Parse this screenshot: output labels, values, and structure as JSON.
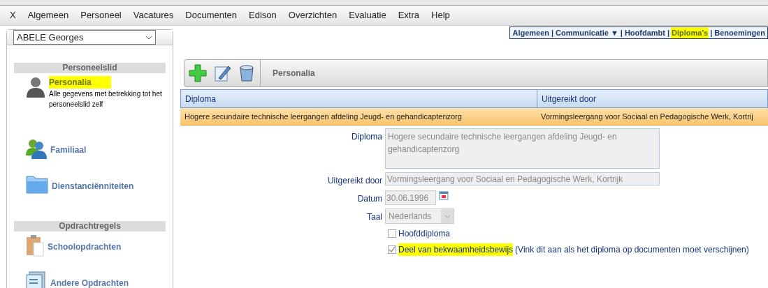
{
  "menu": [
    "X",
    "Algemeen",
    "Personeel",
    "Vacatures",
    "Documenten",
    "Edison",
    "Overzichten",
    "Evaluatie",
    "Extra",
    "Help"
  ],
  "person_select": {
    "value": "ABELE Georges"
  },
  "sidebar": [
    {
      "heading": "Personeelslid",
      "items": [
        {
          "kind": "person",
          "label": "Personalia",
          "description": "Alle gegevens met betrekking tot het personeelslid zelf",
          "selected": true,
          "highlighted": true
        },
        {
          "kind": "people",
          "label": "Familiaal",
          "selected": false,
          "highlighted": false
        },
        {
          "kind": "folder",
          "label": "Dienstanciënniteiten",
          "selected": false,
          "highlighted": false
        }
      ]
    },
    {
      "heading": "Opdrachtregels",
      "items": [
        {
          "kind": "clipboard",
          "label": "Schoolopdrachten",
          "selected": false,
          "highlighted": false
        },
        {
          "kind": "documents",
          "label": "Andere Opdrachten",
          "selected": false,
          "highlighted": false
        }
      ]
    }
  ],
  "tabs": [
    {
      "label": "Algemeen",
      "selected": false,
      "highlighted": false
    },
    {
      "separator": "|",
      "label": "Communicatie ▼",
      "selected": false,
      "highlighted": false
    },
    {
      "separator": "|",
      "label": "Hoofdambt",
      "selected": false,
      "highlighted": false
    },
    {
      "separator": "|",
      "label": "Diploma's",
      "selected": true,
      "highlighted": true
    },
    {
      "separator": "|",
      "label": "Benoemingen",
      "selected": false,
      "highlighted": false
    }
  ],
  "toolbar": {
    "title": "Personalia"
  },
  "table": {
    "columns": [
      "Diploma",
      "Uitgereikt door"
    ],
    "rows": [
      {
        "cells": [
          "Hogere secundaire technische leergangen afdeling Jeugd- en gehandicaptenzorg",
          "Vormingsleergang voor Sociaal en Pedagogische Werk, Kortrij"
        ],
        "selected": true
      }
    ]
  },
  "form": {
    "diploma": {
      "label": "Diploma",
      "value": "Hogere secundaire technische leergangen afdeling Jeugd- en gehandicaptenzorg"
    },
    "issuer": {
      "label": "Uitgereikt door",
      "value": "Vormingsleergang voor Sociaal en Pedagogische Werk, Kortrijk"
    },
    "date": {
      "label": "Datum",
      "value": "30.06.1996"
    },
    "language": {
      "label": "Taal",
      "value": "Nederlands"
    },
    "checkboxes": [
      {
        "label": "Hoofddiploma",
        "checked": false,
        "highlighted": false
      },
      {
        "label": "Deel van bekwaamheidsbewijs",
        "hint": "(Vink dit aan als het diploma op documenten moet verschijnen)",
        "checked": true,
        "highlighted": true
      }
    ]
  }
}
